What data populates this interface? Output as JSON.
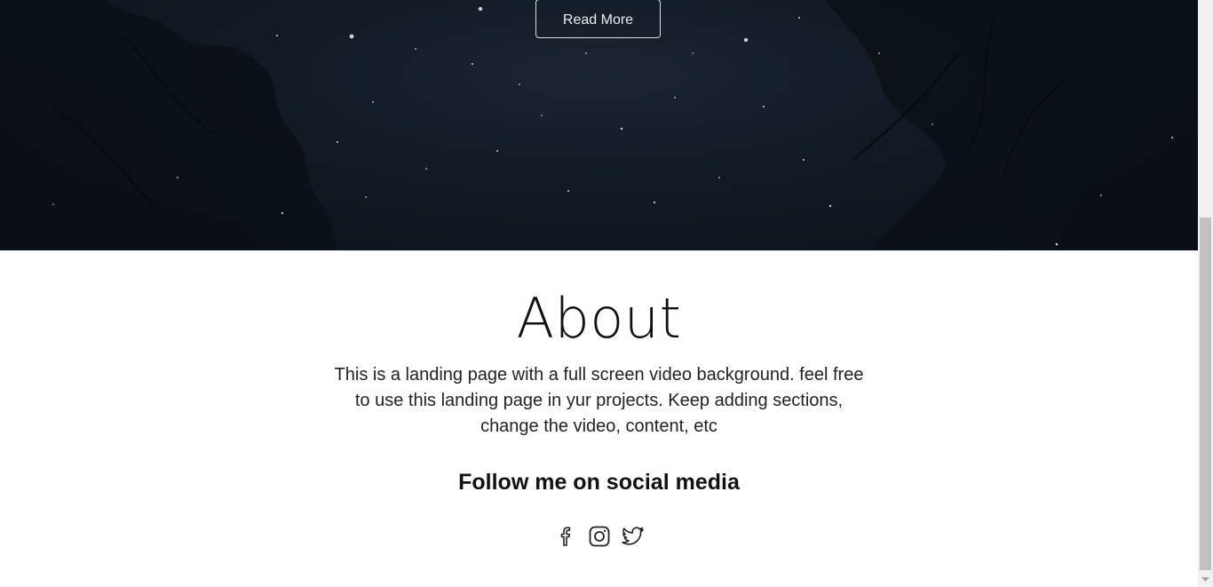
{
  "hero": {
    "read_more_label": "Read More"
  },
  "about": {
    "title": "About",
    "text": "This is a landing page with a full screen video background. feel free to use this landing page in yur projects. Keep adding sections, change the video, content, etc",
    "follow_heading": "Follow me on social media"
  },
  "socials": [
    {
      "icon": "facebook-icon"
    },
    {
      "icon": "instagram-icon"
    },
    {
      "icon": "twitter-icon"
    }
  ],
  "colors": {
    "hero_bg": "#111a23",
    "text": "#111111",
    "button_border": "#d8dde2"
  }
}
